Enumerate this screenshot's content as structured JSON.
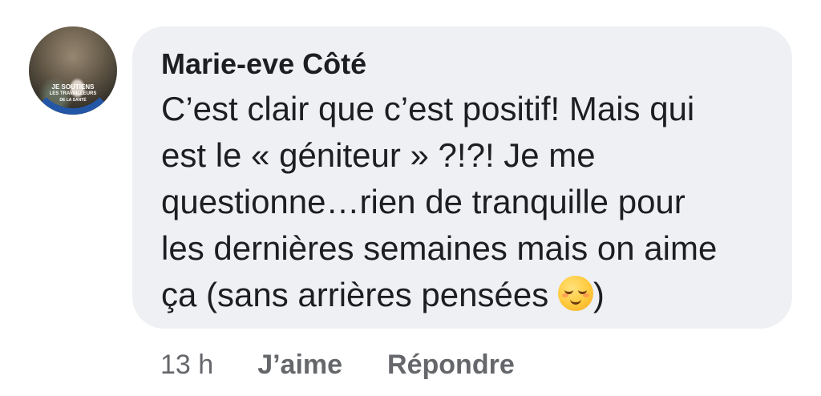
{
  "comment": {
    "author": "Marie-eve Côté",
    "lines": [
      "C’est clair que c’est positif! Mais qui",
      "est le « géniteur » ?!?! Je me",
      "questionne…rien de tranquille pour",
      "les dernières semaines mais on aime",
      "ça (sans arrières pensées "
    ],
    "closing": ")",
    "emoji": "relieved-face-emoji"
  },
  "avatar": {
    "badge_line1": "JE SOUTIENS",
    "badge_line2": "LES TRAVAILLEURS",
    "badge_line3": "DE LA SANTÉ",
    "frame_color": "#2456a6"
  },
  "actions": {
    "time": "13 h",
    "like_label": "J’aime",
    "reply_label": "Répondre"
  },
  "colors": {
    "bubble_bg": "#eef0f4",
    "text": "#1c1e21",
    "secondary_text": "#65676b"
  }
}
